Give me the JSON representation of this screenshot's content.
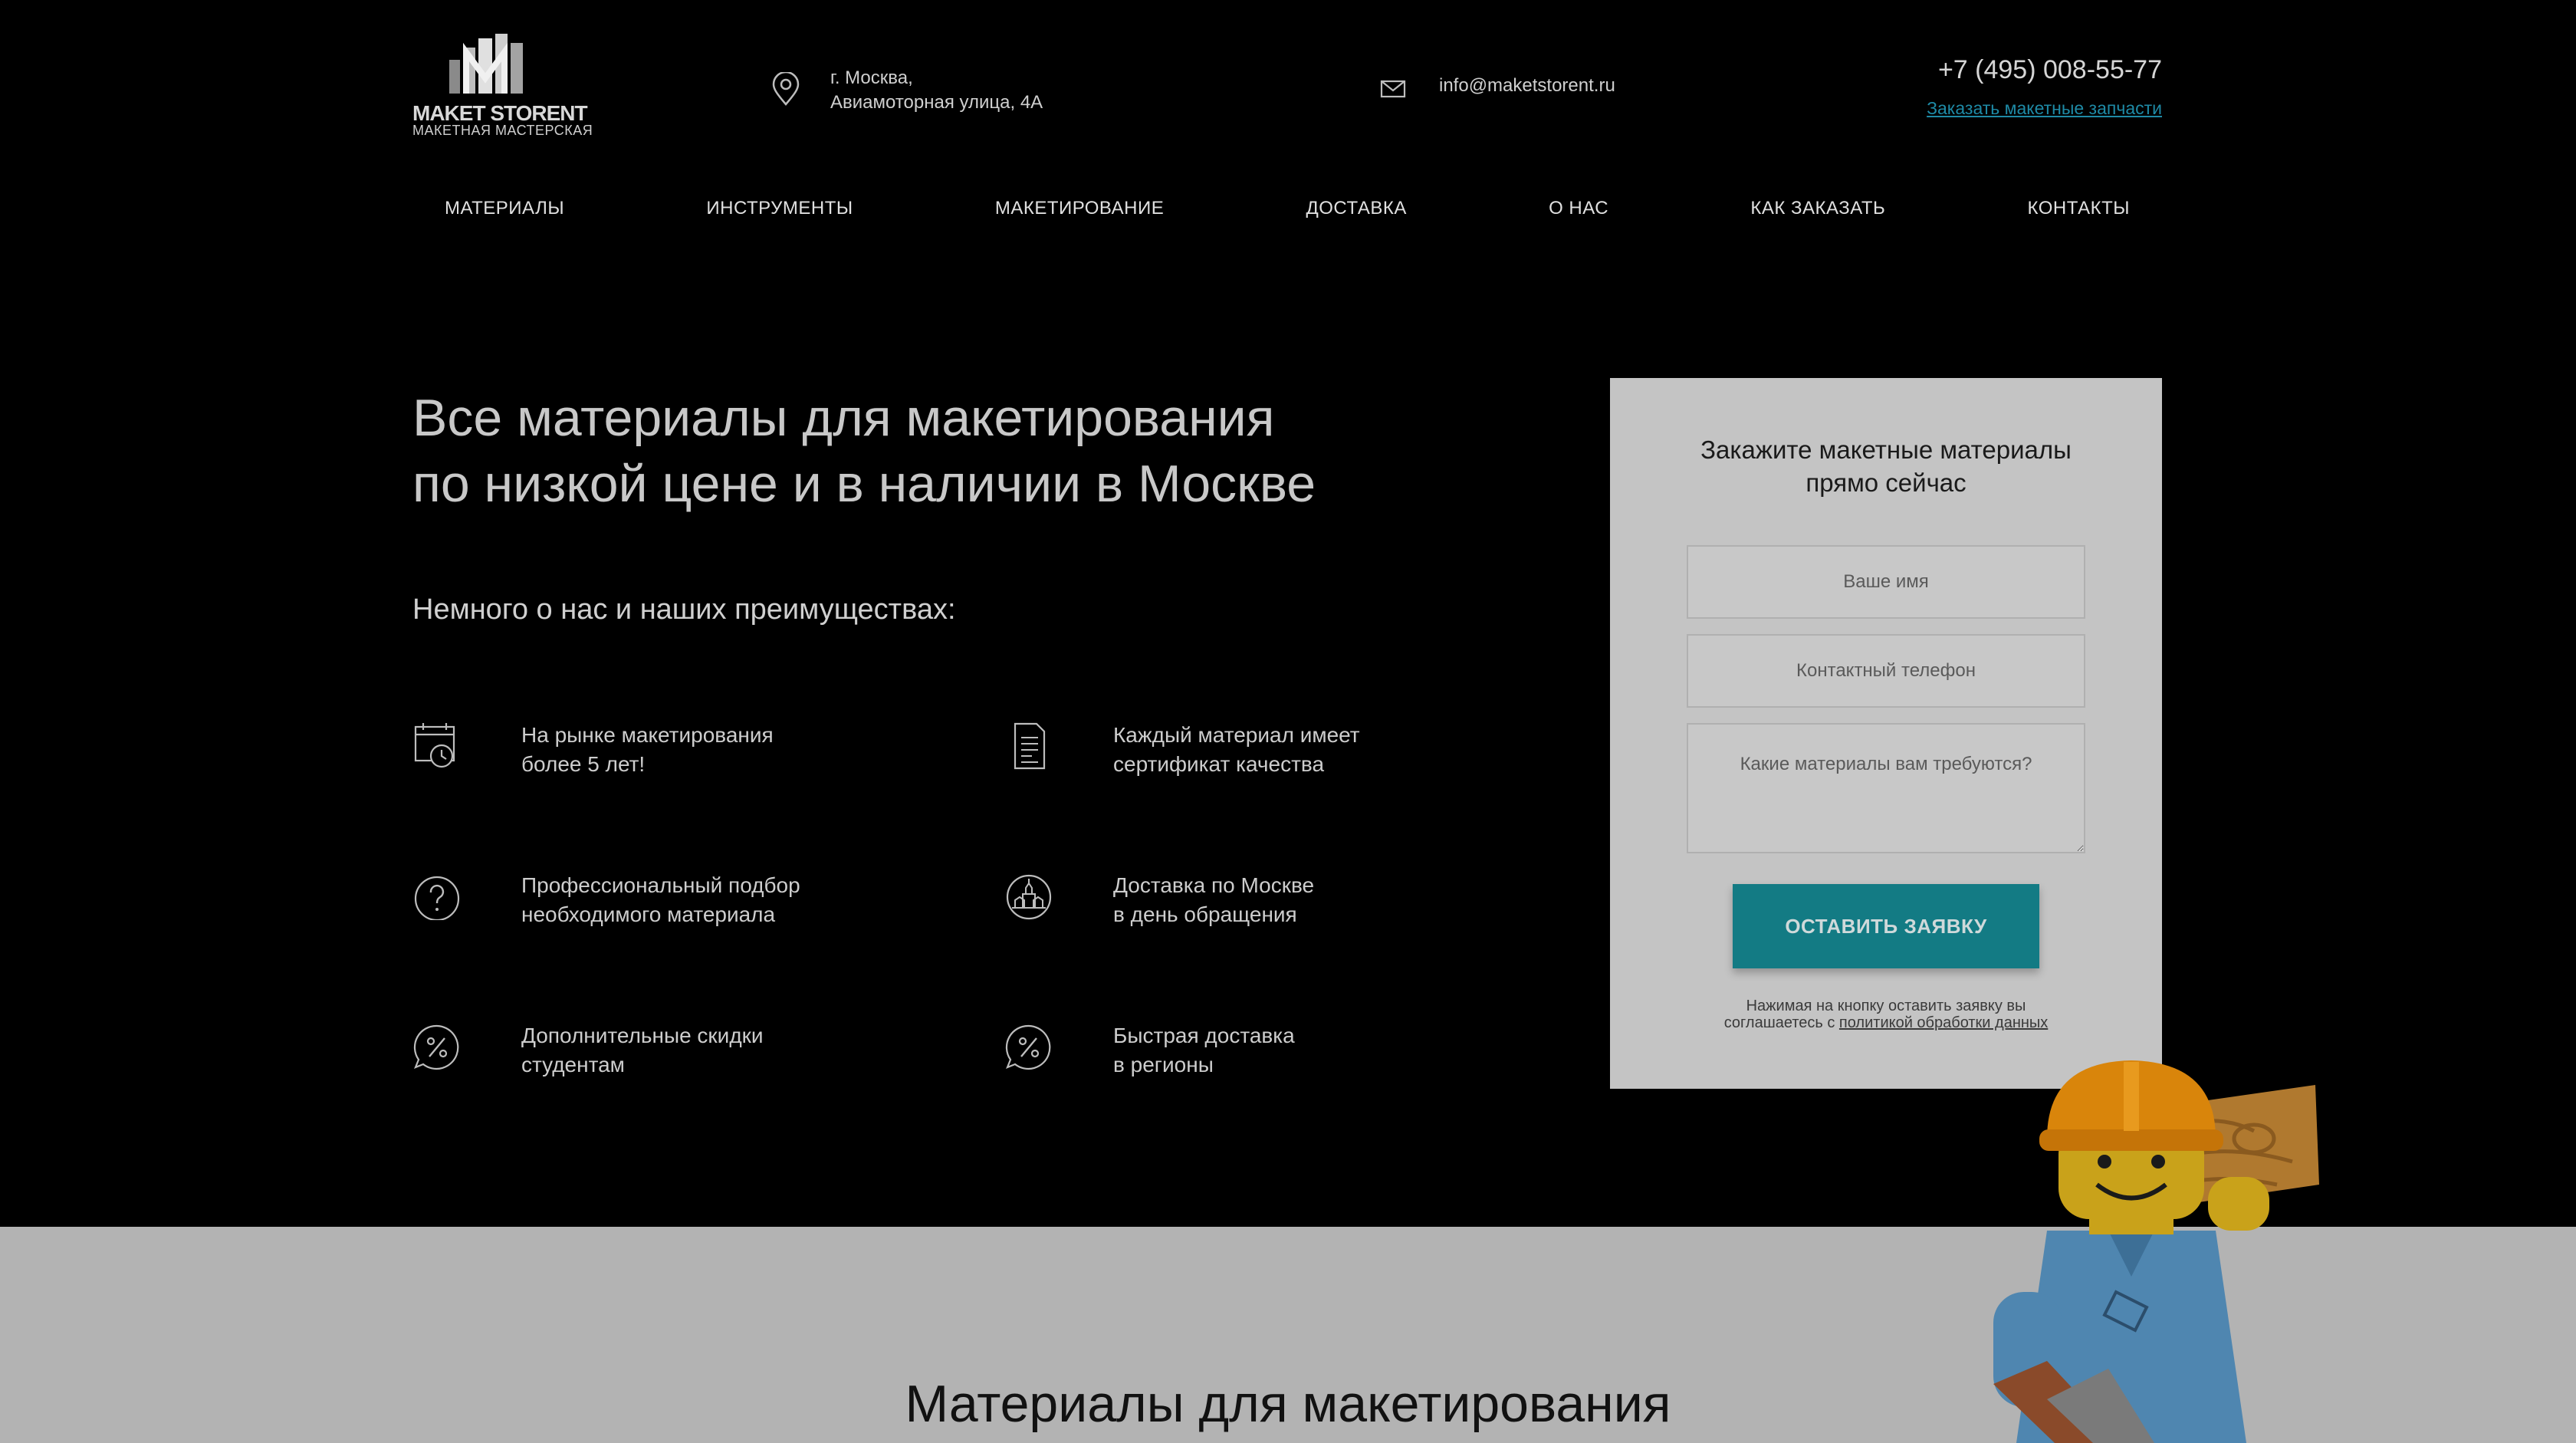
{
  "header": {
    "logo": {
      "title": "MAKET STORENT",
      "subtitle": "МАКЕТНАЯ МАСТЕРСКАЯ"
    },
    "address": {
      "line1": "г. Москва,",
      "line2": "Авиамоторная улица, 4А"
    },
    "email": "info@maketstorent.ru",
    "phone": "+7 (495) 008-55-77",
    "order_link": "Заказать макетные запчасти"
  },
  "nav": {
    "items": [
      {
        "label": "МАТЕРИАЛЫ"
      },
      {
        "label": "ИНСТРУМЕНТЫ"
      },
      {
        "label": "МАКЕТИРОВАНИЕ"
      },
      {
        "label": "ДОСТАВКА"
      },
      {
        "label": "О НАС"
      },
      {
        "label": "КАК ЗАКАЗАТЬ"
      },
      {
        "label": "КОНТАКТЫ"
      }
    ]
  },
  "hero": {
    "title_line1": "Все материалы для макетирования",
    "title_line2": "по низкой цене и в наличии в Москве",
    "subheading": "Немного о нас и наших преимуществах:",
    "features": [
      {
        "icon": "calendar-clock-icon",
        "line1": "На рынке макетирования",
        "line2": "более 5 лет!"
      },
      {
        "icon": "certificate-document-icon",
        "line1": "Каждый материал имеет",
        "line2": "сертификат качества"
      },
      {
        "icon": "question-circle-icon",
        "line1": "Профессиональный подбор",
        "line2": "необходимого материала"
      },
      {
        "icon": "kremlin-badge-icon",
        "line1": "Доставка по Москве",
        "line2": "в день обращения"
      },
      {
        "icon": "percent-bubble-icon",
        "line1": "Дополнительные скидки",
        "line2": "студентам"
      },
      {
        "icon": "percent-bubble-icon",
        "line1": "Быстрая доставка",
        "line2": "в регионы"
      }
    ]
  },
  "form": {
    "title_line1": "Закажите макетные материалы",
    "title_line2": "прямо сейчас",
    "name_placeholder": "Ваше имя",
    "phone_placeholder": "Контактный телефон",
    "materials_placeholder": "Какие материалы вам требуются?",
    "submit_label": "ОСТАВИТЬ ЗАЯВКУ",
    "consent_line1": "Нажимая на кнопку оставить заявку вы",
    "consent_prefix": "соглашаетесь с ",
    "consent_link": "политикой обработки данных"
  },
  "section": {
    "title": "Материалы для макетирования"
  },
  "colors": {
    "background": "#000000",
    "accent": "#137b84",
    "link": "#1e8aa6",
    "form_bg": "#c4c4c4",
    "band_bg": "#b3b3b3"
  }
}
